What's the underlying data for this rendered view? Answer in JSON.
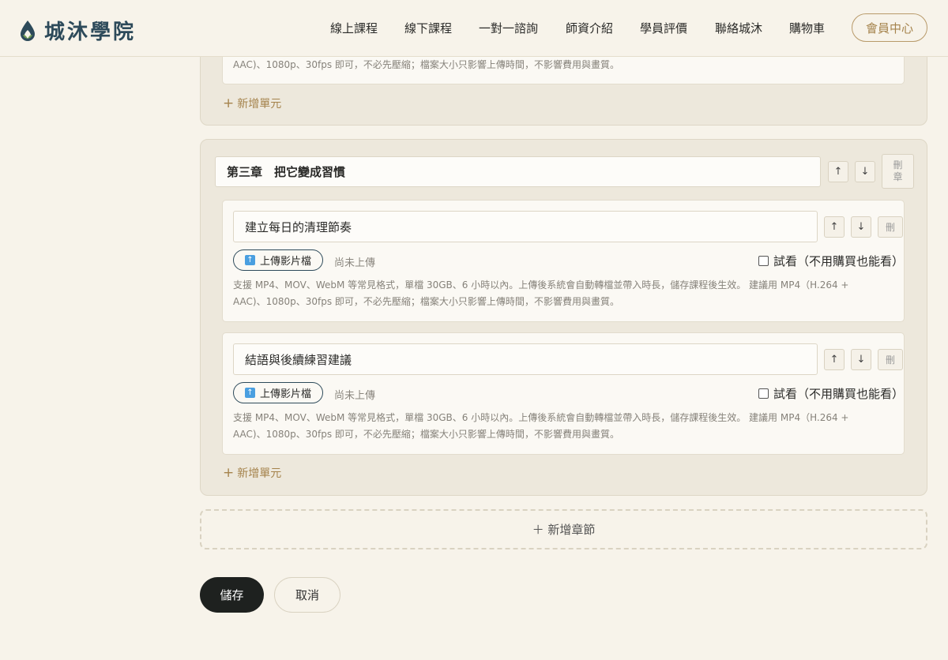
{
  "brand": {
    "name": "城沐學院"
  },
  "nav": {
    "items": [
      "線上課程",
      "線下課程",
      "一對一諮詢",
      "師資介紹",
      "學員評價",
      "聯絡城沐",
      "購物車"
    ],
    "member": "會員中心"
  },
  "prev_chapter": {
    "help_tail": "AAC)、1080p、30fps 即可，不必先壓縮；檔案大小只影響上傳時間，不影響費用與畫質。",
    "add_unit": "新增單元"
  },
  "chapter3": {
    "title": "第三章　把它變成習慣",
    "up": "↑",
    "down": "↓",
    "delete": "刪章",
    "units": [
      {
        "title": "建立每日的清理節奏",
        "upload": "上傳影片檔",
        "status": "尚未上傳",
        "trial": "試看（不用購買也能看）",
        "help1": "支援 MP4、MOV、WebM 等常見格式，單檔 30GB、6 小時以內。上傳後系統會自動轉檔並帶入時長，儲存課程後生效。 建議用 MP4（H.264 +",
        "help2": "AAC)、1080p、30fps 即可，不必先壓縮；檔案大小只影響上傳時間，不影響費用與畫質。",
        "up": "↑",
        "down": "↓",
        "delete": "刪"
      },
      {
        "title": "結語與後續練習建議",
        "upload": "上傳影片檔",
        "status": "尚未上傳",
        "trial": "試看（不用購買也能看）",
        "help1": "支援 MP4、MOV、WebM 等常見格式，單檔 30GB、6 小時以內。上傳後系統會自動轉檔並帶入時長，儲存課程後生效。 建議用 MP4（H.264 +",
        "help2": "AAC)、1080p、30fps 即可，不必先壓縮；檔案大小只影響上傳時間，不影響費用與畫質。",
        "up": "↑",
        "down": "↓",
        "delete": "刪"
      }
    ],
    "add_unit": "新增單元"
  },
  "add_chapter": "＋ 新增章節",
  "actions": {
    "save": "儲存",
    "cancel": "取消"
  },
  "colors": {
    "accent": "#a5834c",
    "brand": "#2d4a5a",
    "primary_button": "#1e211f"
  }
}
